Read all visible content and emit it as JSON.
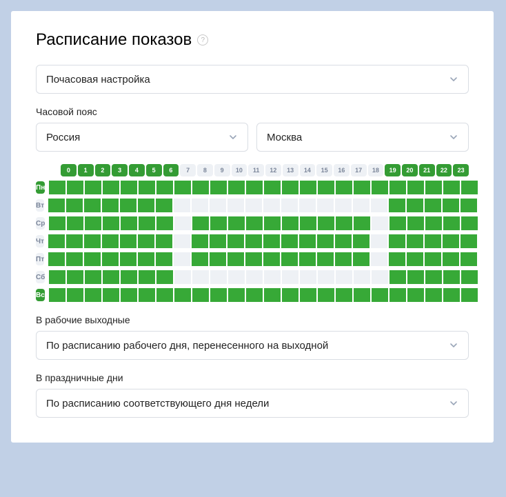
{
  "title": "Расписание показов",
  "mode_select": "Почасовая настройка",
  "tz_label": "Часовой пояс",
  "tz_country": "Россия",
  "tz_city": "Москва",
  "hours": [
    0,
    1,
    2,
    3,
    4,
    5,
    6,
    7,
    8,
    9,
    10,
    11,
    12,
    13,
    14,
    15,
    16,
    17,
    18,
    19,
    20,
    21,
    22,
    23
  ],
  "hour_header_on": [
    true,
    true,
    true,
    true,
    true,
    true,
    true,
    false,
    false,
    false,
    false,
    false,
    false,
    false,
    false,
    false,
    false,
    false,
    false,
    true,
    true,
    true,
    true,
    true
  ],
  "days": [
    {
      "label": "Пн",
      "label_on": true,
      "cells": [
        1,
        1,
        1,
        1,
        1,
        1,
        1,
        1,
        1,
        1,
        1,
        1,
        1,
        1,
        1,
        1,
        1,
        1,
        1,
        1,
        1,
        1,
        1,
        1
      ]
    },
    {
      "label": "Вт",
      "label_on": false,
      "cells": [
        1,
        1,
        1,
        1,
        1,
        1,
        1,
        0,
        0,
        0,
        0,
        0,
        0,
        0,
        0,
        0,
        0,
        0,
        0,
        1,
        1,
        1,
        1,
        1
      ]
    },
    {
      "label": "Ср",
      "label_on": false,
      "cells": [
        1,
        1,
        1,
        1,
        1,
        1,
        1,
        0,
        1,
        1,
        1,
        1,
        1,
        1,
        1,
        1,
        1,
        1,
        0,
        1,
        1,
        1,
        1,
        1
      ]
    },
    {
      "label": "Чт",
      "label_on": false,
      "cells": [
        1,
        1,
        1,
        1,
        1,
        1,
        1,
        0,
        1,
        1,
        1,
        1,
        1,
        1,
        1,
        1,
        1,
        1,
        0,
        1,
        1,
        1,
        1,
        1
      ]
    },
    {
      "label": "Пт",
      "label_on": false,
      "cells": [
        1,
        1,
        1,
        1,
        1,
        1,
        1,
        0,
        1,
        1,
        1,
        1,
        1,
        1,
        1,
        1,
        1,
        1,
        0,
        1,
        1,
        1,
        1,
        1
      ]
    },
    {
      "label": "Сб",
      "label_on": false,
      "cells": [
        1,
        1,
        1,
        1,
        1,
        1,
        1,
        0,
        0,
        0,
        0,
        0,
        0,
        0,
        0,
        0,
        0,
        0,
        0,
        1,
        1,
        1,
        1,
        1
      ]
    },
    {
      "label": "Вс",
      "label_on": true,
      "cells": [
        1,
        1,
        1,
        1,
        1,
        1,
        1,
        1,
        1,
        1,
        1,
        1,
        1,
        1,
        1,
        1,
        1,
        1,
        1,
        1,
        1,
        1,
        1,
        1
      ]
    }
  ],
  "working_weekends_label": "В рабочие выходные",
  "working_weekends_value": "По расписанию рабочего дня, перенесенного на выходной",
  "holidays_label": "В праздничные дни",
  "holidays_value": "По расписанию соответствующего дня недели"
}
